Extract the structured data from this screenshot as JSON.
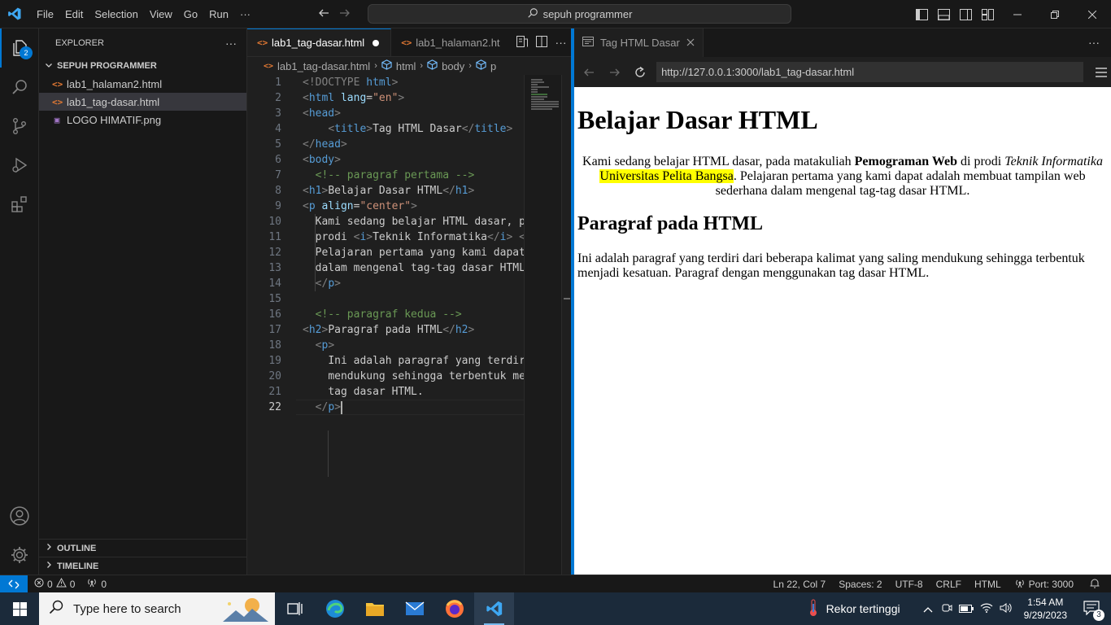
{
  "titlebar": {
    "menus": [
      "File",
      "Edit",
      "Selection",
      "View",
      "Go",
      "Run"
    ],
    "more": "···",
    "search_text": "sepuh programmer"
  },
  "activity": {
    "explorer_badge": "2"
  },
  "sidebar": {
    "title": "EXPLORER",
    "more": "···",
    "folder": "SEPUH PROGRAMMER",
    "files": [
      {
        "icon": "<>",
        "name": "lab1_halaman2.html"
      },
      {
        "icon": "<>",
        "name": "lab1_tag-dasar.html"
      },
      {
        "icon": "▣",
        "name": "LOGO HIMATIF.png"
      }
    ],
    "outline": "OUTLINE",
    "timeline": "TIMELINE"
  },
  "editor": {
    "tabs": [
      {
        "icon": "<>",
        "label": "lab1_tag-dasar.html"
      },
      {
        "icon": "<>",
        "label": "lab1_halaman2.ht"
      }
    ],
    "breadcrumb": [
      "lab1_tag-dasar.html",
      "html",
      "body",
      "p"
    ],
    "line_numbers": [
      "1",
      "2",
      "3",
      "4",
      "5",
      "6",
      "7",
      "8",
      "9",
      "10",
      "11",
      "12",
      "13",
      "14",
      "15",
      "16",
      "17",
      "18",
      "19",
      "20",
      "21",
      "22"
    ],
    "code": {
      "l1_doctype": "<!DOCTYPE",
      "l1_html": "html",
      "l2_open": "<html",
      "l2_attr": "lang",
      "l2_val": "\"en\"",
      "l4_text": "Tag HTML Dasar",
      "l7_comment": "<!-- paragraf pertama -->",
      "l8_text": "Belajar Dasar HTML",
      "l9_attr": "align",
      "l9_val": "\"center\"",
      "l10": "Kami sedang belajar HTML dasar, pa",
      "l11_a": "prodi ",
      "l11_b": "Teknik Informatika",
      "l12": "Pelajaran pertama yang kami dapat",
      "l13": "dalam mengenal tag-tag dasar HTML",
      "l16_comment": "<!-- paragraf kedua -->",
      "l17_text": "Paragraf pada HTML",
      "l19": "Ini adalah paragraf yang terdir",
      "l20": "mendukung sehingga terbentuk mer",
      "l21": "tag dasar HTML."
    }
  },
  "browser": {
    "tab_label": "Tag HTML Dasar",
    "url": "http://127.0.0.1:3000/lab1_tag-dasar.html",
    "page": {
      "h1": "Belajar Dasar HTML",
      "p1_a": "Kami sedang belajar HTML dasar, pada matakuliah ",
      "p1_bold": "Pemograman Web",
      "p1_b": " di prodi ",
      "p1_italic": "Teknik Informatika",
      "p1_highlight": "Universitas Pelita Bangsa",
      "p1_c": ". Pelajaran pertama yang kami dapat adalah membuat tampilan web sederhana dalam mengenal tag-tag dasar HTML.",
      "h2": "Paragraf pada HTML",
      "p2": "Ini adalah paragraf yang terdiri dari beberapa kalimat yang saling mendukung sehingga terbentuk menjadi kesatuan. Paragraf dengan menggunakan tag dasar HTML."
    }
  },
  "statusbar": {
    "errors": "0",
    "warnings": "0",
    "ports": "0",
    "position": "Ln 22, Col 7",
    "spaces": "Spaces: 2",
    "encoding": "UTF-8",
    "eol": "CRLF",
    "language": "HTML",
    "port": "Port: 3000"
  },
  "taskbar": {
    "search_placeholder": "Type here to search",
    "weather_text": "Rekor tertinggi",
    "time": "1:54 AM",
    "date": "9/29/2023",
    "notif_count": "3"
  },
  "colors": {
    "accent": "#0078d4",
    "highlight": "#ffff00"
  }
}
